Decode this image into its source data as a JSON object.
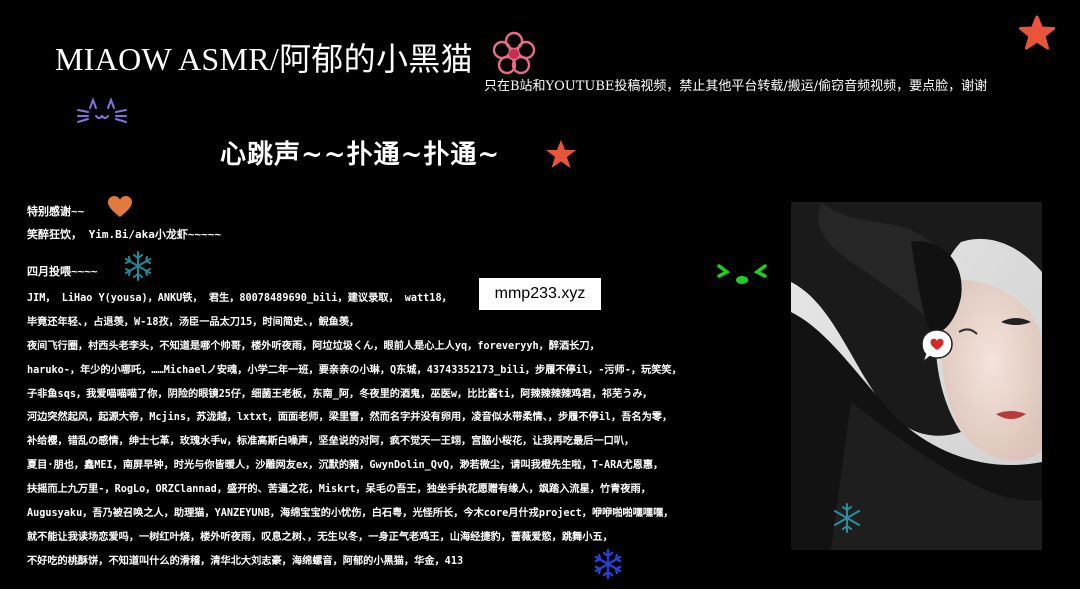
{
  "header": {
    "title": "MIAOW ASMR/阿郁的小黑猫",
    "notice": "只在B站和YOUTUBE投稿视频，禁止其他平台转载/搬运/偷窃音频视频，要点脸，谢谢",
    "subtitle": "心跳声~~扑通~扑通~"
  },
  "thanks": {
    "special_title": "特别感谢~~",
    "special_line": "笑醉狂饮， Yim.Bi/aka小龙虾~~~~~",
    "month_title": "四月投喂~~~~"
  },
  "donors": [
    "JIM， LiHao Y(yousa)，ANKU铁， 君生，80078489690_bili，建议录取， watt18，",
    "毕竟还年轻、，占退羡，W-18孜，汤臣一品太刀15，时间简史、，鲵鱼羡，",
    "夜间飞行圈，村西头老李头，不知道是哪个帅哥，楼外听夜雨，阿垃垃圾くん，眼前人是心上人yq，foreveryyh，醉酒长刀，",
    "haruko-，年少的小哪吒，……Michaelノ安魂，小学二年一班，要亲亲の小琳，Q东城，43743352173_bili，步履不停il，-污师-，玩笑笑，",
    "子非鱼sqs，我爱喵喵喵了你，阴险的眼镜25仔，细菌王老板，东南_阿，冬夜里的酒鬼，巫医w，比比酱ti，阿辣辣辣辣鸡君，祁芜うみ，",
    "河边突然起风，起源大帝，Mcjins，苏泷越，lxtxt，面面老师，梁里雪，然而名字并没有卵用，凌音似水带柔情、，步履不停il，吾名为零，",
    "补给樱，错乱の感情，绅士七革，玫瑰水手w，标准高斯白噪声，坚垒说的对阿，疯不觉天一王翊，宫脇小桜花，让我再吃最后一口叭，",
    "夏目·朋也，鑫MEI，南屏早钟，时光与你皆暖人，沙雕网友ex，沉默的豬，GwynDolin_QvQ，渺若微尘，请叫我橙先生啦，T-ARA尤恩惠，",
    "扶摇而上九万里-，RogLo，ORZClannad，盛开的、苦逼之花，Miskrt，呆毛の吾王，独坐手执花愿赠有缘人，飒踏入流星，竹青夜雨，",
    "Augusyaku，吾乃被召唤之人，助理猫，YANZEYUNB，海绵宝宝的小忧伤，白石粤，光怪所长，今木core月什戎project，咿咿啪啪嘿嘿嘿，",
    "就不能让我读场恋爱吗，一树红叶烧，楼外听夜雨，叹息之树、，无生以冬，一身正气老鸡王，山海经捷豹，蔷薇爱慾，跳舞小五，",
    "不好吃的桃酥饼，不知道叫什么的滑稽，清华北大刘志豪，海绵螺音，阿郁的小黑猫，华金，413"
  ],
  "watermark": "mmp233.xyz",
  "icons": {
    "flower": "pink-flower-icon",
    "cat": "cat-face-icon",
    "star_orange": "orange-star-icon",
    "heart": "heart-icon",
    "snowflake": "snowflake-icon",
    "face": "green-face-icon",
    "speech_heart": "speech-bubble-heart-icon"
  },
  "colors": {
    "background": "#000000",
    "text": "#ffffff",
    "star": "#e8553a",
    "heart": "#e27a3f",
    "snow_teal": "#1f8a9a",
    "snow_blue": "#2a3fd0",
    "face_green": "#22cc22",
    "flower_pink": "#e96b88",
    "cat_purple": "#8a6fe0"
  }
}
